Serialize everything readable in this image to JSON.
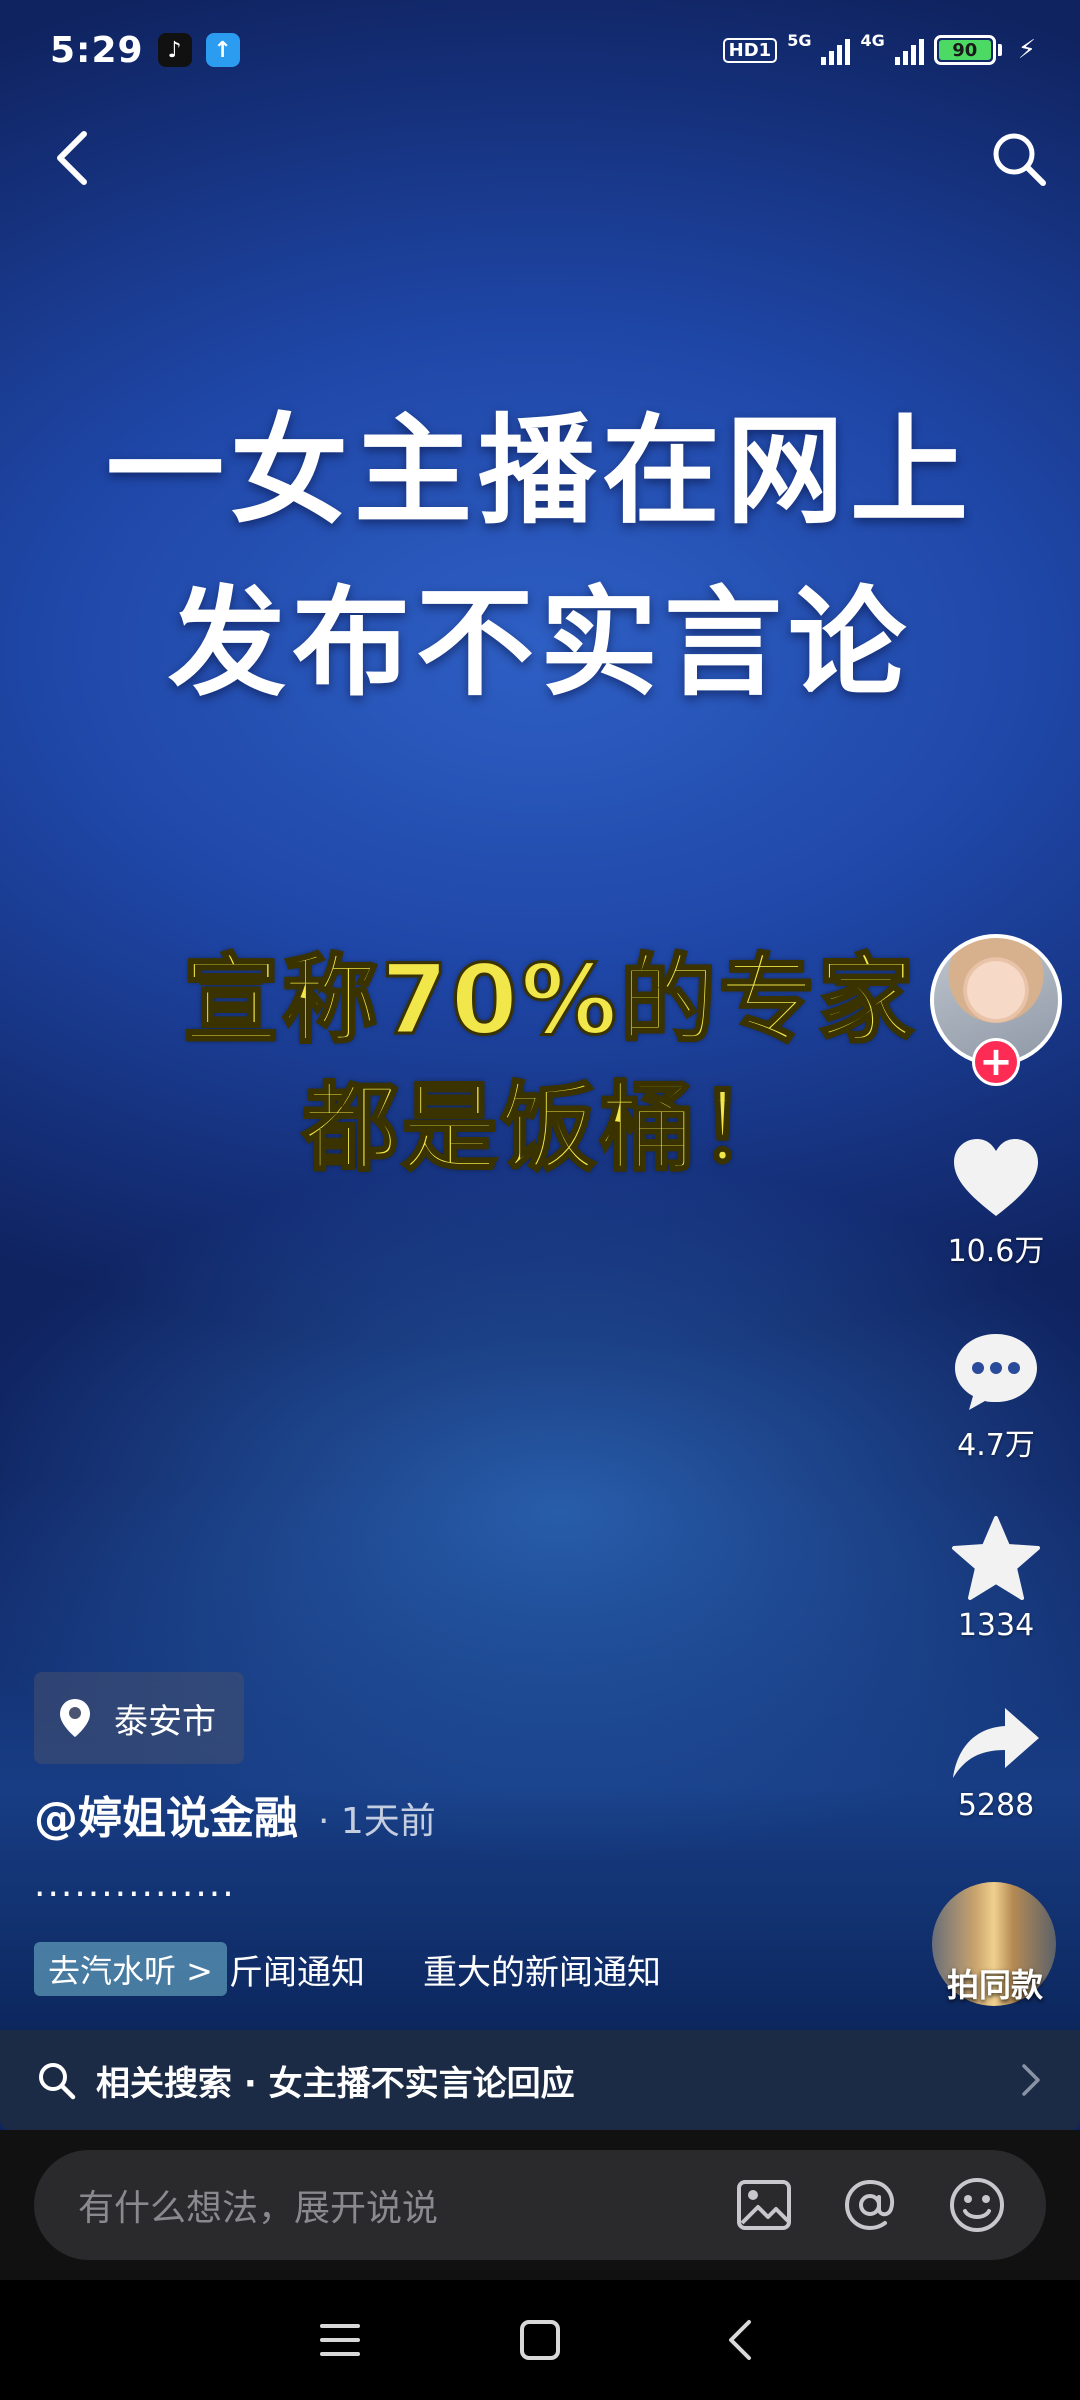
{
  "status": {
    "time": "5:29",
    "hd": "HD1",
    "net1": "5G",
    "net2": "4G",
    "battery": "90"
  },
  "video": {
    "headline_line1": "一女主播在网上",
    "headline_line2": "发布不实言论",
    "subhead_line1": "宣称70%的专家",
    "subhead_line2": "都是饭桶！"
  },
  "actions": {
    "like_count": "10.6万",
    "comment_count": "4.7万",
    "favorite_count": "1334",
    "share_count": "5288",
    "follow_symbol": "+",
    "music_label": "拍同款"
  },
  "info": {
    "location": "泰安市",
    "author": "@婷姐说金融",
    "time_ago": "· 1天前",
    "caption": "...............",
    "qishui_button": "去汽水听 >",
    "music_title_1": "斤闻通知",
    "music_title_2": "重大的新闻通知"
  },
  "related": {
    "text": "相关搜索 · 女主播不实言论回应"
  },
  "comment_bar": {
    "placeholder": "有什么想法，展开说说"
  },
  "colors": {
    "headline": "#ffffff",
    "subhead": "#f1e64a",
    "follow": "#fe2c55",
    "battery": "#4cd964"
  }
}
